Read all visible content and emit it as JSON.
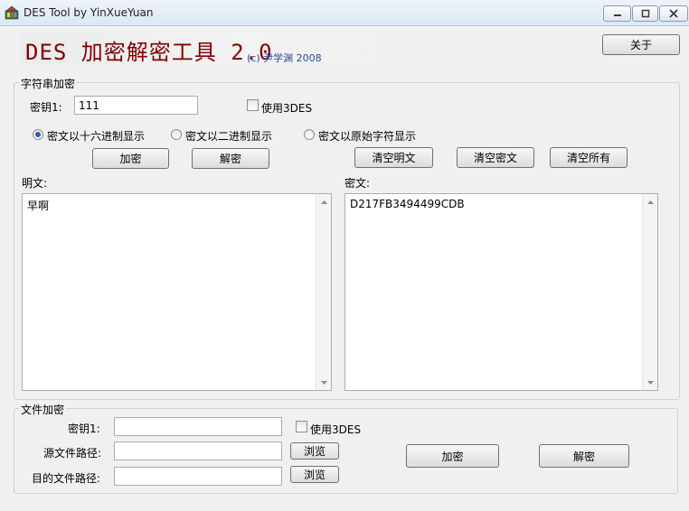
{
  "window": {
    "title": "DES Tool by YinXueYuan"
  },
  "header": {
    "heading": "DES 加密解密工具 2.0",
    "copyright": "(c) 尹学渊 2008",
    "about_label": "关于"
  },
  "string_section": {
    "legend": "字符串加密",
    "key_label": "密钥1:",
    "key_value": "111",
    "use_3des_label": "使用3DES",
    "use_3des_checked": false,
    "display_options": [
      {
        "label": "密文以十六进制显示",
        "selected": true
      },
      {
        "label": "密文以二进制显示",
        "selected": false
      },
      {
        "label": "密文以原始字符显示",
        "selected": false
      }
    ],
    "encrypt_label": "加密",
    "decrypt_label": "解密",
    "clear_plain_label": "清空明文",
    "clear_cipher_label": "清空密文",
    "clear_all_label": "清空所有",
    "plaintext_label": "明文:",
    "plaintext_value": "早啊",
    "ciphertext_label": "密文:",
    "ciphertext_value": "D217FB3494499CDB"
  },
  "file_section": {
    "legend": "文件加密",
    "key_label": "密钥1:",
    "key_value": "",
    "use_3des_label": "使用3DES",
    "use_3des_checked": false,
    "source_label": "源文件路径:",
    "source_value": "",
    "dest_label": "目的文件路径:",
    "dest_value": "",
    "browse_label": "浏览",
    "encrypt_label": "加密",
    "decrypt_label": "解密"
  },
  "colors": {
    "heading": "#800000",
    "copyright": "#2c4aa0",
    "radio_selected": "#2b5fb3"
  }
}
